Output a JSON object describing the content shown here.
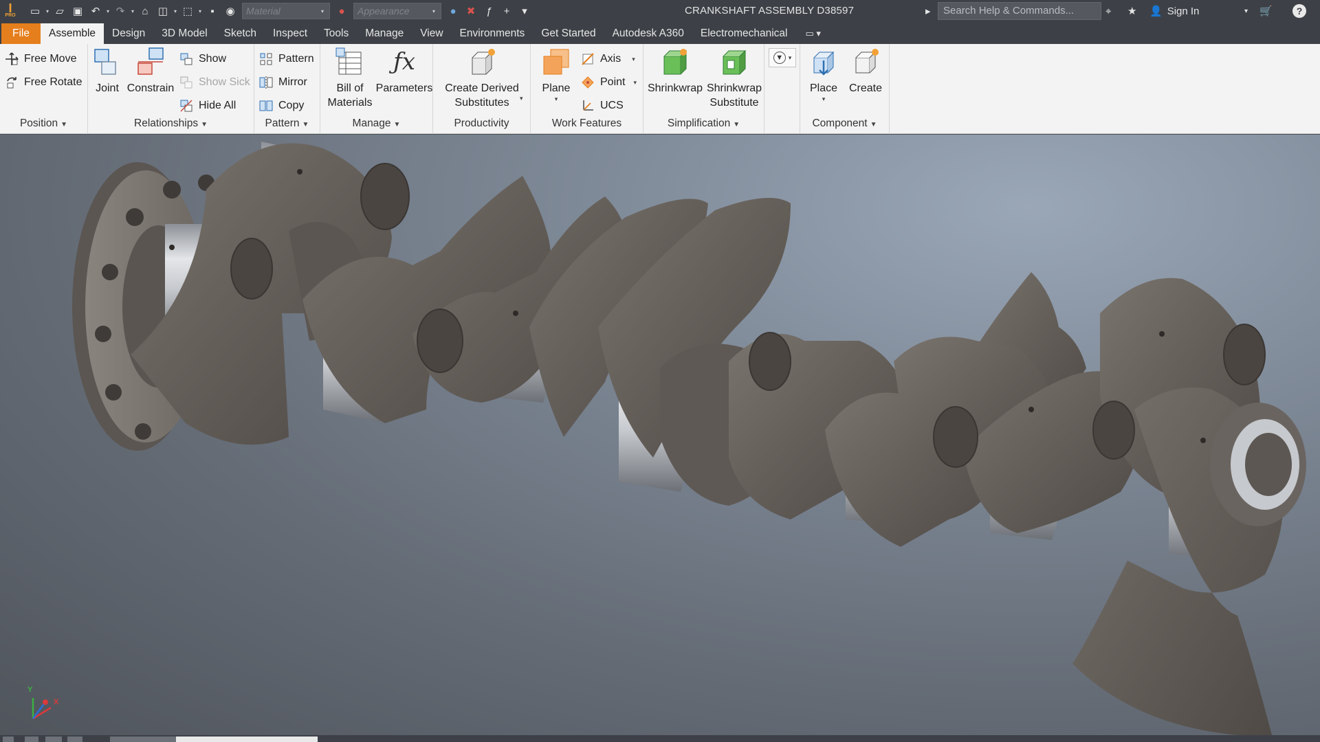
{
  "app": {
    "logo_text": "I",
    "logo_sub": "PRO",
    "document_title": "CRANKSHAFT ASSEMBLY D38597"
  },
  "quick_access": {
    "material_placeholder": "Material",
    "appearance_placeholder": "Appearance",
    "search_placeholder": "Search Help & Commands...",
    "sign_in": "Sign In"
  },
  "tabs": [
    {
      "label": "File"
    },
    {
      "label": "Assemble"
    },
    {
      "label": "Design"
    },
    {
      "label": "3D Model"
    },
    {
      "label": "Sketch"
    },
    {
      "label": "Inspect"
    },
    {
      "label": "Tools"
    },
    {
      "label": "Manage"
    },
    {
      "label": "View"
    },
    {
      "label": "Environments"
    },
    {
      "label": "Get Started"
    },
    {
      "label": "Autodesk A360"
    },
    {
      "label": "Electromechanical"
    }
  ],
  "active_tab": "Assemble",
  "ribbon": {
    "position": {
      "label": "Position",
      "free_move": "Free Move",
      "free_rotate": "Free Rotate"
    },
    "relationships": {
      "label": "Relationships",
      "joint": "Joint",
      "constrain": "Constrain",
      "show": "Show",
      "show_sick": "Show Sick",
      "hide_all": "Hide All"
    },
    "pattern": {
      "label": "Pattern",
      "pattern": "Pattern",
      "mirror": "Mirror",
      "copy": "Copy"
    },
    "manage": {
      "label": "Manage",
      "bom_line1": "Bill of",
      "bom_line2": "Materials",
      "parameters": "Parameters"
    },
    "productivity": {
      "label": "Productivity",
      "cds_line1": "Create Derived",
      "cds_line2": "Substitutes"
    },
    "work_features": {
      "label": "Work Features",
      "plane": "Plane",
      "axis": "Axis",
      "point": "Point",
      "ucs": "UCS"
    },
    "simplification": {
      "label": "Simplification",
      "shrinkwrap": "Shrinkwrap",
      "sws_line1": "Shrinkwrap",
      "sws_line2": "Substitute"
    },
    "component": {
      "label": "Component",
      "place": "Place",
      "create": "Create"
    }
  },
  "colors": {
    "file_tab": "#e57e1c",
    "title_bar": "#3d4147",
    "ribbon_bg": "#f3f3f3",
    "model_body": "#66605b",
    "journal": "#c9ccd0"
  },
  "triad": {
    "x_label": "X",
    "y_label": "Y"
  }
}
